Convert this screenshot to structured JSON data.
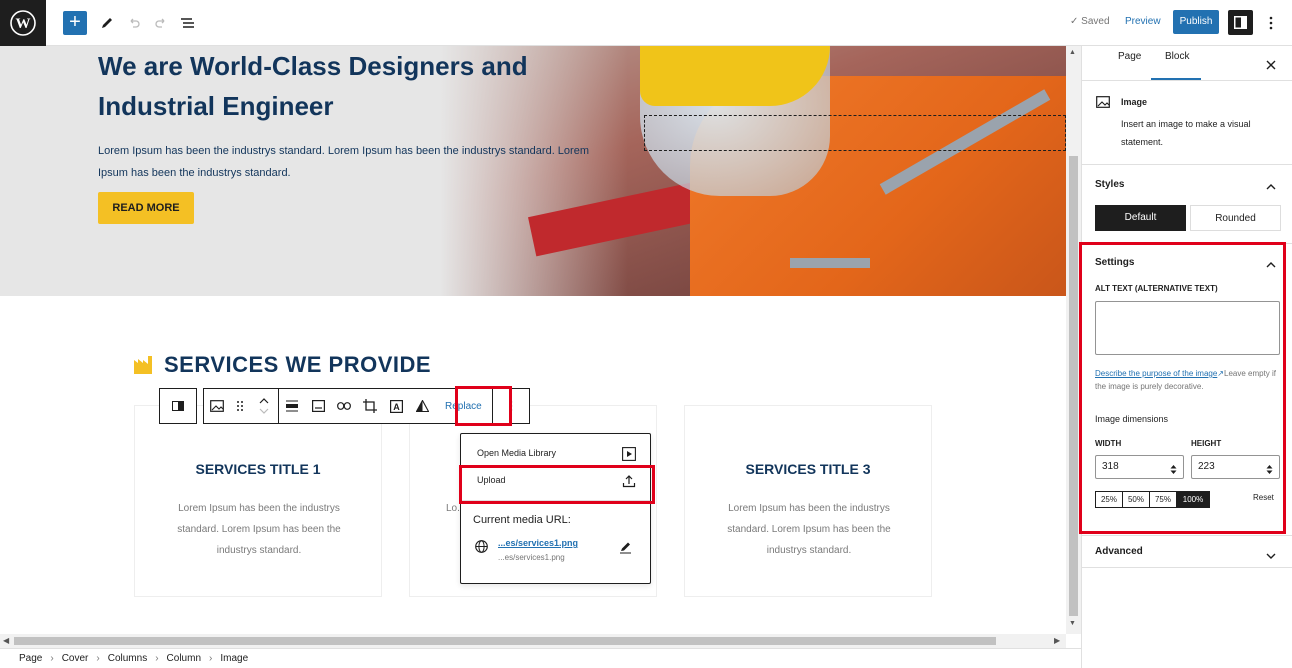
{
  "topbar": {
    "saved_label": "Saved",
    "preview_label": "Preview",
    "publish_label": "Publish",
    "icons": [
      "wordpress-logo",
      "plus-icon",
      "pencil-icon",
      "undo-icon",
      "redo-icon",
      "list-view-icon",
      "settings-toggle-icon",
      "kebab-icon"
    ]
  },
  "hero": {
    "title": "We are World-Class Designers and Industrial Engineer",
    "text": "Lorem Ipsum has been the industrys standard. Lorem Ipsum has been the industrys standard. Lorem Ipsum has been the industrys standard.",
    "button_label": "READ MORE",
    "accent_color": "#f4c024"
  },
  "services": {
    "heading": "SERVICES WE PROVIDE",
    "cards": [
      {
        "title": "SERVICES TITLE 1",
        "text": "Lorem Ipsum has been the industrys standard. Lorem Ipsum has been the industrys standard."
      },
      {
        "title": "",
        "text": "Lo..."
      },
      {
        "title": "SERVICES TITLE 3",
        "text": "Lorem Ipsum has been the industrys standard. Lorem Ipsum has been the industrys standard."
      }
    ],
    "cut_text": "....."
  },
  "block_toolbar": {
    "replace_label": "Replace"
  },
  "replace_menu": {
    "open_media_library": "Open Media Library",
    "upload": "Upload",
    "current_media_url_label": "Current media URL:",
    "url_link": "...es/services1.png",
    "url_sub": "...es/services1.png"
  },
  "breadcrumb": [
    "Page",
    "Cover",
    "Columns",
    "Column",
    "Image"
  ],
  "sidebar": {
    "tabs": [
      "Page",
      "Block"
    ],
    "active_tab": "Block",
    "block_name": "Image",
    "block_desc": "Insert an image to make a visual statement.",
    "styles_title": "Styles",
    "style_default": "Default",
    "style_rounded": "Rounded",
    "settings_title": "Settings",
    "alt_label": "ALT TEXT (ALTERNATIVE TEXT)",
    "alt_value": "",
    "alt_help_link": "Describe the purpose of the image",
    "alt_help_rest": "Leave empty if the image is purely decorative.",
    "dimensions_title": "Image dimensions",
    "width_label": "WIDTH",
    "height_label": "HEIGHT",
    "width_value": "318",
    "height_value": "223",
    "percent_options": [
      "25%",
      "50%",
      "75%",
      "100%"
    ],
    "percent_selected": "100%",
    "reset_label": "Reset",
    "advanced_title": "Advanced"
  }
}
